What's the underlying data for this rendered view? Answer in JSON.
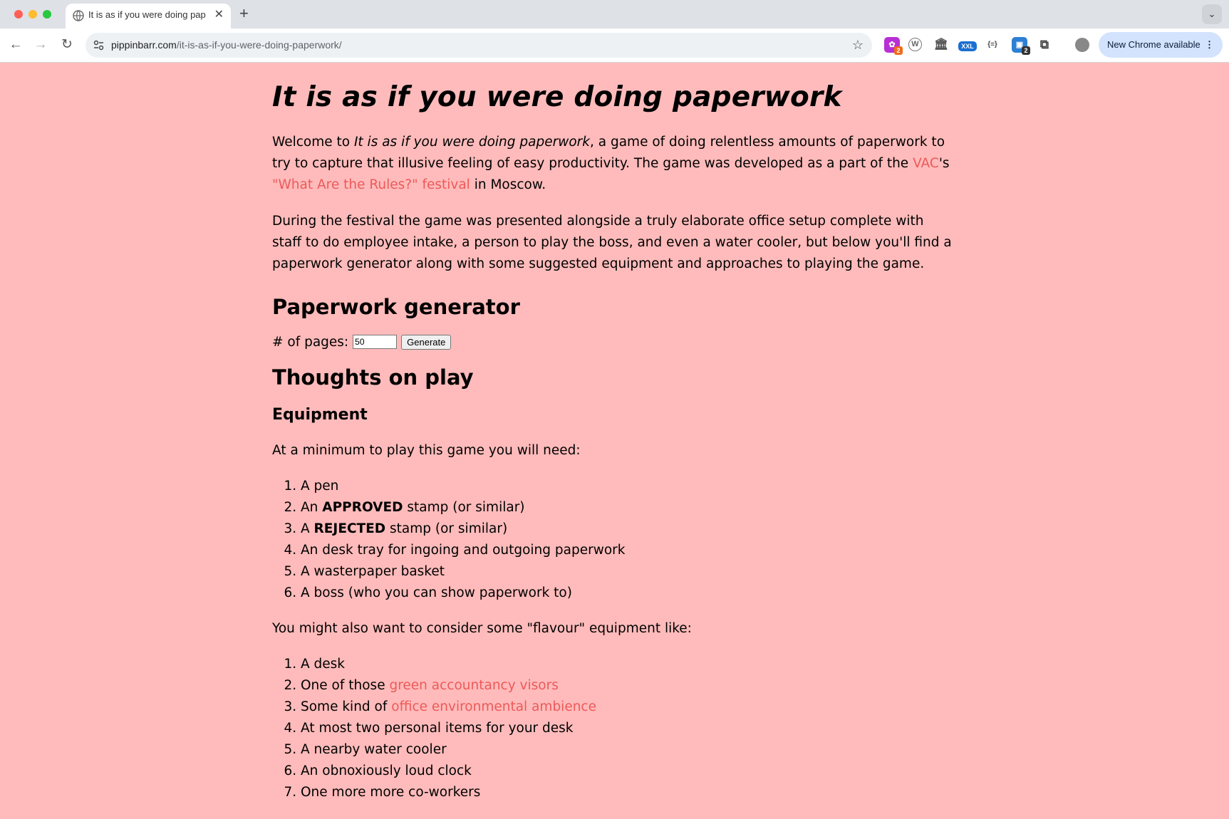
{
  "browser": {
    "tab": {
      "title": "It is as if you were doing paperwork"
    },
    "url": {
      "host": "pippinbarr.com",
      "path": "/it-is-as-if-you-were-doing-paperwork/"
    },
    "update_button": "New Chrome available",
    "extensions": [
      {
        "name": "flower-extension-icon",
        "badge": "2",
        "color": "#b72fd6"
      },
      {
        "name": "wordpress-extension-icon",
        "badge": "",
        "color": "#6b6b6b"
      },
      {
        "name": "museum-extension-icon",
        "badge": "",
        "color": "#6b6b6b"
      },
      {
        "name": "xxl-extension-icon",
        "label": "XXL",
        "badge": "",
        "color": "#1a6fd1"
      },
      {
        "name": "json-extension-icon",
        "label": "{≡}",
        "badge": "",
        "color": "#6b6b6b"
      },
      {
        "name": "puzzle-counter-extension-icon",
        "badge": "2",
        "color": "#2d7fd3"
      }
    ]
  },
  "page": {
    "title": "It is as if you were doing paperwork",
    "intro": {
      "welcome": "Welcome to ",
      "game_title": "It is as if you were doing paperwork",
      "rest1": ", a game of doing relentless amounts of paperwork to try to capture that illusive feeling of easy productivity. The game was developed as a part of the ",
      "vac_link": "VAC",
      "apos": "'s ",
      "festival_link": "\"What Are the Rules?\" festival",
      "rest2": " in Moscow."
    },
    "festival_paragraph": "During the festival the game was presented alongside a truly elaborate office setup complete with staff to do employee intake, a person to play the boss, and even a water cooler, but below you'll find a paperwork generator along with some suggested equipment and approaches to playing the game.",
    "generator": {
      "heading": "Paperwork generator",
      "pages_label": "# of pages:",
      "pages_value": "50",
      "button_label": "Generate"
    },
    "thoughts_heading": "Thoughts on play",
    "equipment_heading": "Equipment",
    "minimum_intro": "At a minimum to play this game you will need:",
    "minimum_items": [
      {
        "text": "A pen"
      },
      {
        "pre": "An ",
        "bold": "APPROVED",
        "post": " stamp (or similar)"
      },
      {
        "pre": "A ",
        "bold": "REJECTED",
        "post": " stamp (or similar)"
      },
      {
        "text": "An desk tray for ingoing and outgoing paperwork"
      },
      {
        "text": "A wasterpaper basket"
      },
      {
        "text": "A boss (who you can show paperwork to)"
      }
    ],
    "flavour_intro": "You might also want to consider some \"flavour\" equipment like:",
    "flavour_items": [
      {
        "text": "A desk"
      },
      {
        "pre": "One of those ",
        "link": "green accountancy visors"
      },
      {
        "pre": "Some kind of ",
        "link": "office environmental ambience"
      },
      {
        "text": "At most two personal items for your desk"
      },
      {
        "text": "A nearby water cooler"
      },
      {
        "text": "An obnoxiously loud clock"
      },
      {
        "text": "One more more co-workers"
      }
    ],
    "colors": {
      "background": "#ffbbbb",
      "link": "#ec5a5a"
    }
  }
}
